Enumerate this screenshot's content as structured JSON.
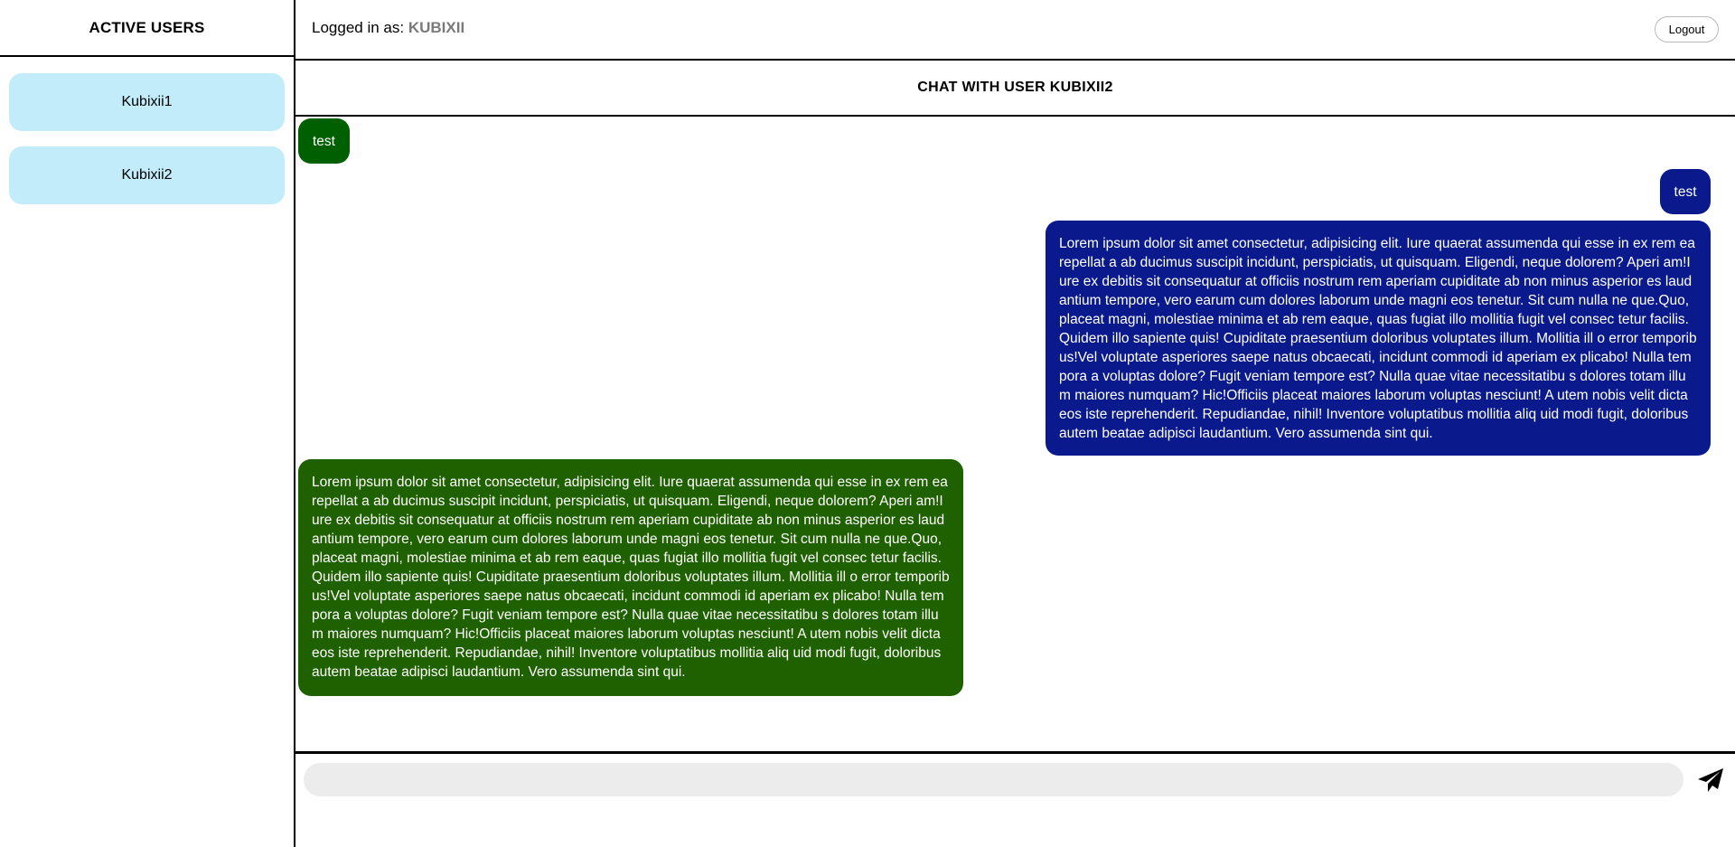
{
  "sidebar": {
    "title": "ACTIVE USERS",
    "users": [
      {
        "label": "Kubixii1"
      },
      {
        "label": "Kubixii2"
      }
    ]
  },
  "topbar": {
    "login_prefix": "Logged in as:",
    "login_user": "KUBIXII",
    "logout_label": "Logout"
  },
  "chat": {
    "title": "CHAT WITH USER KUBIXII2",
    "messages": [
      {
        "direction": "received",
        "text": "test"
      },
      {
        "direction": "sent",
        "text": "test"
      },
      {
        "direction": "sent",
        "text": "Lorem ipsum dolor sit amet consectetur, adipisicing elit. Iure quaerat assumenda qui esse in ex rem ea repellat a ab ducimus suscipit incidunt, perspiciatis, ut quisquam. Eligendi, neque dolorem? Aperi am!Iure ex debitis sit consequatur at officiis nostrum rem aperiam cupiditate ab non minus asperior es laudantium tempore, vero earum cum dolores laborum unde magni eos tenetur. Sit cum nulla ne que.Quo, placeat magni, molestiae minima et ab rem eaque, quas fugiat illo mollitia fugit vel consec tetur facilis. Quidem illo sapiente quis! Cupiditate praesentium doloribus voluptates illum. Mollitia ill o error temporibus!Vel voluptate asperiores saepe natus obcaecati, incidunt commodi id aperiam ex plicabo! Nulla tempora a voluptas dolore? Fugit veniam tempore est? Nulla quae vitae necessitatibu s dolores totam illum maiores numquam? Hic!Officiis placeat maiores laborum voluptas nesciunt! A utem nobis velit dicta eos iste reprehenderit. Repudiandae, nihil! Inventore voluptatibus mollitia aliq uid modi fugit, doloribus autem beatae adipisci laudantium. Vero assumenda sint qui."
      },
      {
        "direction": "received",
        "text": "Lorem ipsum dolor sit amet consectetur, adipisicing elit. Iure quaerat assumenda qui esse in ex rem ea repellat a ab ducimus suscipit incidunt, perspiciatis, ut quisquam. Eligendi, neque dolorem? Aperi am!Iure ex debitis sit consequatur at officiis nostrum rem aperiam cupiditate ab non minus asperior es laudantium tempore, vero earum cum dolores laborum unde magni eos tenetur. Sit cum nulla ne que.Quo, placeat magni, molestiae minima et ab rem eaque, quas fugiat illo mollitia fugit vel consec tetur facilis. Quidem illo sapiente quis! Cupiditate praesentium doloribus voluptates illum. Mollitia ill o error temporibus!Vel voluptate asperiores saepe natus obcaecati, incidunt commodi id aperiam ex plicabo! Nulla tempora a voluptas dolore? Fugit veniam tempore est? Nulla quae vitae necessitatibu s dolores totam illum maiores numquam? Hic!Officiis placeat maiores laborum voluptas nesciunt! A utem nobis velit dicta eos iste reprehenderit. Repudiandae, nihil! Inventore voluptatibus mollitia aliq uid modi fugit, doloribus autem beatae adipisci laudantium. Vero assumenda sint qui."
      }
    ]
  },
  "composer": {
    "input_value": "",
    "input_placeholder": "",
    "send_icon": "send-icon"
  },
  "colors": {
    "user_item_bg": "#c3ecfb",
    "received_bubble": "#005f00",
    "received_bubble_long": "#1f6100",
    "sent_bubble": "#0a1a8c",
    "input_bg": "#ececec",
    "login_user_text": "#7a7a7a"
  }
}
